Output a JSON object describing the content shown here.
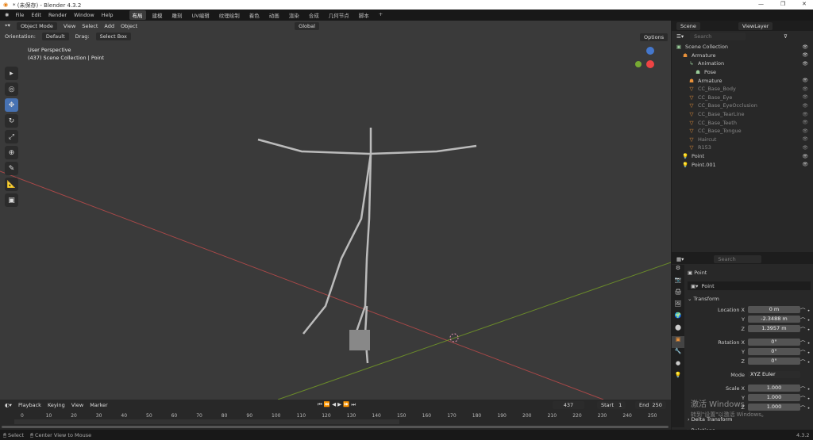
{
  "window": {
    "title": "* (未保存) - Blender 4.3.2"
  },
  "menu": [
    "File",
    "Edit",
    "Render",
    "Window",
    "Help"
  ],
  "workspaces": [
    "布局",
    "建模",
    "雕刻",
    "UV编辑",
    "纹理绘制",
    "着色",
    "动画",
    "渲染",
    "合成",
    "几何节点",
    "脚本",
    "+"
  ],
  "viewport": {
    "mode": "Object Mode",
    "menus": [
      "View",
      "Select",
      "Add",
      "Object"
    ],
    "orientation_label": "Orientation:",
    "orientation": "Default",
    "drag_label": "Drag:",
    "drag": "Select Box",
    "transform_orientation": "Global",
    "options": "Options",
    "overlay_title": "User Perspective",
    "overlay_sub": "(437) Scene Collection | Point"
  },
  "scene": {
    "label": "Scene",
    "view_layer": "ViewLayer",
    "search_placeholder": "Search"
  },
  "outliner": [
    {
      "label": "Scene Collection",
      "icon": "collection-icon",
      "indent": 0
    },
    {
      "label": "Armature",
      "icon": "armature-icon",
      "indent": 1
    },
    {
      "label": "Animation",
      "icon": "animation-icon",
      "indent": 2
    },
    {
      "label": "Pose",
      "icon": "pose-icon",
      "indent": 3
    },
    {
      "label": "Armature",
      "icon": "armature-data-icon",
      "indent": 2
    },
    {
      "label": "CC_Base_Body",
      "icon": "mesh-icon",
      "indent": 2,
      "dim": true
    },
    {
      "label": "CC_Base_Eye",
      "icon": "mesh-icon",
      "indent": 2,
      "dim": true
    },
    {
      "label": "CC_Base_EyeOcclusion",
      "icon": "mesh-icon",
      "indent": 2,
      "dim": true
    },
    {
      "label": "CC_Base_TearLine",
      "icon": "mesh-icon",
      "indent": 2,
      "dim": true
    },
    {
      "label": "CC_Base_Teeth",
      "icon": "mesh-icon",
      "indent": 2,
      "dim": true
    },
    {
      "label": "CC_Base_Tongue",
      "icon": "mesh-icon",
      "indent": 2,
      "dim": true
    },
    {
      "label": "Haircut",
      "icon": "mesh-icon",
      "indent": 2,
      "dim": true
    },
    {
      "label": "R153",
      "icon": "mesh-icon",
      "indent": 2,
      "dim": true
    },
    {
      "label": "Point",
      "icon": "light-icon",
      "indent": 1
    },
    {
      "label": "Point.001",
      "icon": "light-icon",
      "indent": 1
    }
  ],
  "properties": {
    "object_name": "Point",
    "data_name": "Point",
    "panel": "Transform",
    "location": {
      "label": "Location X",
      "x": "0 m",
      "y": "-2.3488 m",
      "z": "1.3957 m"
    },
    "rotation": {
      "label": "Rotation X",
      "x": "0°",
      "y": "0°",
      "z": "0°"
    },
    "mode_label": "Mode",
    "mode": "XYZ Euler",
    "scale": {
      "label": "Scale X",
      "x": "1.000",
      "y": "1.000",
      "z": "1.000"
    },
    "axis_y": "Y",
    "axis_z": "Z",
    "delta": "Delta Transform",
    "relations": "Relations",
    "watermark1": "激活 Windows",
    "watermark2": "转到\"设置\"以激活 Windows。"
  },
  "timeline": {
    "menus": [
      "Playback",
      "Keying",
      "View",
      "Marker"
    ],
    "current_frame": "437",
    "start_label": "Start",
    "start": "1",
    "end_label": "End",
    "end": "250",
    "ticks": [
      "0",
      "10",
      "20",
      "30",
      "40",
      "50",
      "60",
      "70",
      "80",
      "90",
      "100",
      "110",
      "120",
      "130",
      "140",
      "150",
      "160",
      "170",
      "180",
      "190",
      "200",
      "210",
      "220",
      "230",
      "240",
      "250"
    ]
  },
  "status": {
    "select": "Select",
    "center": "Center View to Mouse",
    "version": "4.3.2"
  }
}
